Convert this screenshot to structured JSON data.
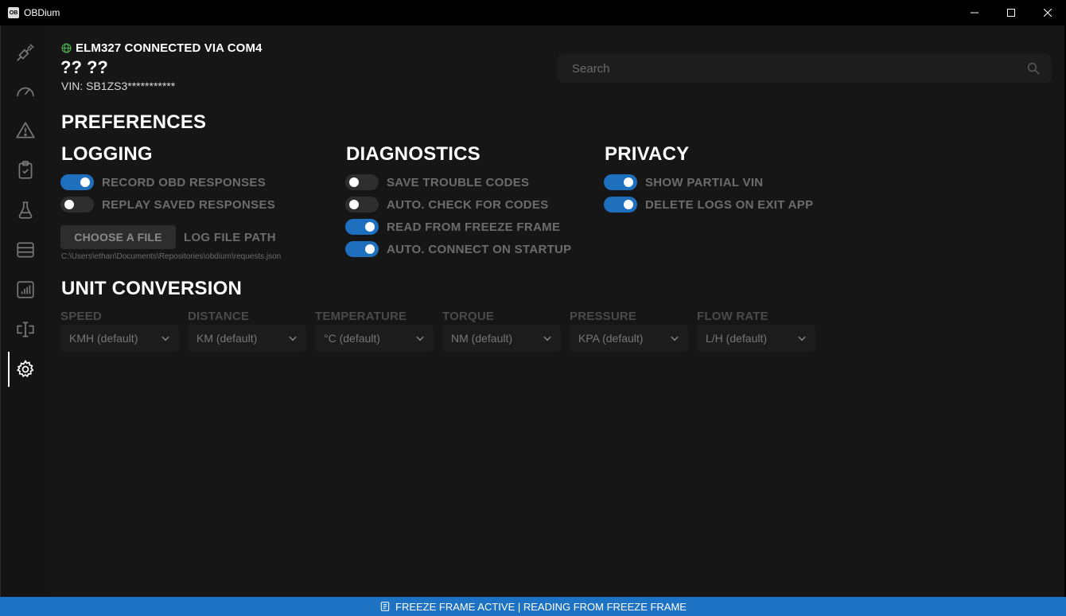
{
  "window": {
    "title": "OBDium",
    "icon_text": "OB"
  },
  "sidebar": {
    "items": [
      {
        "icon": "plug-icon",
        "active": false
      },
      {
        "icon": "gauge-icon",
        "active": false
      },
      {
        "icon": "warning-icon",
        "active": false
      },
      {
        "icon": "clipboard-check-icon",
        "active": false
      },
      {
        "icon": "flask-icon",
        "active": false
      },
      {
        "icon": "database-icon",
        "active": false
      },
      {
        "icon": "bar-chart-icon",
        "active": false
      },
      {
        "icon": "text-cursor-icon",
        "active": false
      },
      {
        "icon": "gear-icon",
        "active": true
      }
    ]
  },
  "header": {
    "connection": "ELM327 CONNECTED VIA COM4",
    "vehicle": "?? ??",
    "vin": "VIN: SB1ZS3***********"
  },
  "search": {
    "placeholder": "Search"
  },
  "preferences": {
    "title": "PREFERENCES",
    "logging": {
      "title": "LOGGING",
      "toggles": [
        {
          "label": "RECORD OBD RESPONSES",
          "on": true
        },
        {
          "label": "REPLAY SAVED RESPONSES",
          "on": false
        }
      ],
      "choose_button": "CHOOSE A FILE",
      "path_label": "LOG FILE PATH",
      "path_value": "C:\\Users\\ethan\\Documents\\Repositories\\obdium\\requests.json"
    },
    "diagnostics": {
      "title": "DIAGNOSTICS",
      "toggles": [
        {
          "label": "SAVE TROUBLE CODES",
          "on": false
        },
        {
          "label": "AUTO. CHECK FOR CODES",
          "on": false
        },
        {
          "label": "READ FROM FREEZE FRAME",
          "on": true
        },
        {
          "label": "AUTO. CONNECT ON STARTUP",
          "on": true
        }
      ]
    },
    "privacy": {
      "title": "PRIVACY",
      "toggles": [
        {
          "label": "SHOW PARTIAL VIN",
          "on": true
        },
        {
          "label": "DELETE LOGS ON EXIT APP",
          "on": true
        }
      ]
    }
  },
  "units": {
    "title": "UNIT CONVERSION",
    "fields": [
      {
        "label": "SPEED",
        "value": "KMH (default)"
      },
      {
        "label": "DISTANCE",
        "value": "KM (default)"
      },
      {
        "label": "TEMPERATURE",
        "value": "°C (default)"
      },
      {
        "label": "TORQUE",
        "value": "NM (default)"
      },
      {
        "label": "PRESSURE",
        "value": "KPA (default)"
      },
      {
        "label": "FLOW RATE",
        "value": "L/H (default)"
      }
    ]
  },
  "status": {
    "text": "FREEZE FRAME ACTIVE | READING FROM FREEZE FRAME"
  },
  "colors": {
    "accent": "#1f6fbf",
    "statusbar": "#1e72c4",
    "background": "#161616",
    "connected_icon": "#4caf50"
  }
}
